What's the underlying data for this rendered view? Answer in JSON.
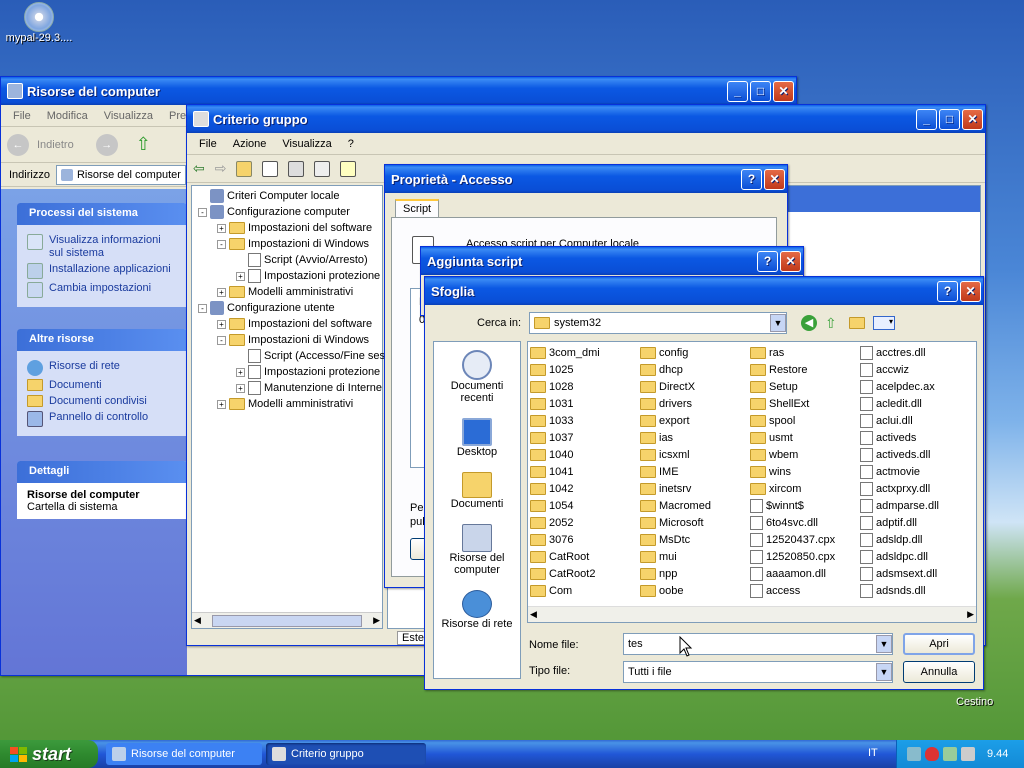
{
  "desktop": {
    "icon_label": "mypal-29.3....",
    "recycle_label": "Cestino"
  },
  "mycomputer": {
    "title": "Risorse del computer",
    "menu": [
      "File",
      "Modifica",
      "Visualizza",
      "Prefe"
    ],
    "back": "Indietro",
    "address_label": "Indirizzo",
    "address_value": "Risorse del computer",
    "panels": [
      {
        "title": "Processi del sistema",
        "items": [
          "Visualizza informazioni sul sistema",
          "Installazione applicazioni",
          "Cambia impostazioni"
        ]
      },
      {
        "title": "Altre risorse",
        "items": [
          "Risorse di rete",
          "Documenti",
          "Documenti condivisi",
          "Pannello di controllo"
        ]
      }
    ],
    "details": {
      "title": "Dettagli",
      "name": "Risorse del computer",
      "desc": "Cartella di sistema"
    }
  },
  "gpedit": {
    "title": "Criterio gruppo",
    "menu": [
      "File",
      "Azione",
      "Visualizza",
      "?"
    ],
    "tree": [
      {
        "t": "Criteri Computer locale",
        "l": 0,
        "pm": ""
      },
      {
        "t": "Configurazione computer",
        "l": 0,
        "pm": "-"
      },
      {
        "t": "Impostazioni del software",
        "l": 1,
        "pm": "+"
      },
      {
        "t": "Impostazioni di Windows",
        "l": 1,
        "pm": "-"
      },
      {
        "t": "Script (Avvio/Arresto)",
        "l": 2,
        "pm": ""
      },
      {
        "t": "Impostazioni protezione",
        "l": 2,
        "pm": "+"
      },
      {
        "t": "Modelli amministrativi",
        "l": 1,
        "pm": "+"
      },
      {
        "t": "Configurazione utente",
        "l": 0,
        "pm": "-"
      },
      {
        "t": "Impostazioni del software",
        "l": 1,
        "pm": "+"
      },
      {
        "t": "Impostazioni di Windows",
        "l": 1,
        "pm": "-"
      },
      {
        "t": "Script (Accesso/Fine ses",
        "l": 2,
        "pm": ""
      },
      {
        "t": "Impostazioni protezione",
        "l": 2,
        "pm": "+"
      },
      {
        "t": "Manutenzione di Interne",
        "l": 2,
        "pm": "+"
      },
      {
        "t": "Modelli amministrativi",
        "l": 1,
        "pm": "+"
      }
    ],
    "tab_label": "Estes"
  },
  "props": {
    "title": "Proprietà - Accesso",
    "tab": "Script",
    "desc": "Accesso script per Computer locale",
    "n1": "N",
    "n2": "0",
    "p1": "Per",
    "p2": "pul"
  },
  "addscript": {
    "title": "Aggiunta script"
  },
  "browse": {
    "title": "Sfoglia",
    "lookin_label": "Cerca in:",
    "lookin_value": "system32",
    "places": [
      "Documenti recenti",
      "Desktop",
      "Documenti",
      "Risorse del computer",
      "Risorse di rete"
    ],
    "columns": [
      [
        "3com_dmi",
        "1025",
        "1028",
        "1031",
        "1033",
        "1037",
        "1040",
        "1041",
        "1042",
        "1054",
        "2052",
        "3076",
        "CatRoot",
        "CatRoot2",
        "Com"
      ],
      [
        "config",
        "dhcp",
        "DirectX",
        "drivers",
        "export",
        "ias",
        "icsxml",
        "IME",
        "inetsrv",
        "Macromed",
        "Microsoft",
        "MsDtc",
        "mui",
        "npp",
        "oobe"
      ],
      [
        "ras",
        "Restore",
        "Setup",
        "ShellExt",
        "spool",
        "usmt",
        "wbem",
        "wins",
        "xircom",
        "$winnt$",
        "6to4svc.dll",
        "12520437.cpx",
        "12520850.cpx",
        "aaaamon.dll",
        "access"
      ],
      [
        "acctres.dll",
        "accwiz",
        "acelpdec.ax",
        "acledit.dll",
        "aclui.dll",
        "activeds",
        "activeds.dll",
        "actmovie",
        "actxprxy.dll",
        "admparse.dll",
        "adptif.dll",
        "adsldp.dll",
        "adsldpc.dll",
        "adsmsext.dll",
        "adsnds.dll"
      ]
    ],
    "filename_label": "Nome file:",
    "filename_value": "tes",
    "filetype_label": "Tipo file:",
    "filetype_value": "Tutti i file",
    "open": "Apri",
    "cancel": "Annulla"
  },
  "taskbar": {
    "start": "start",
    "tasks": [
      "Risorse del computer",
      "Criterio gruppo"
    ],
    "lang": "IT",
    "clock": "9.44"
  }
}
